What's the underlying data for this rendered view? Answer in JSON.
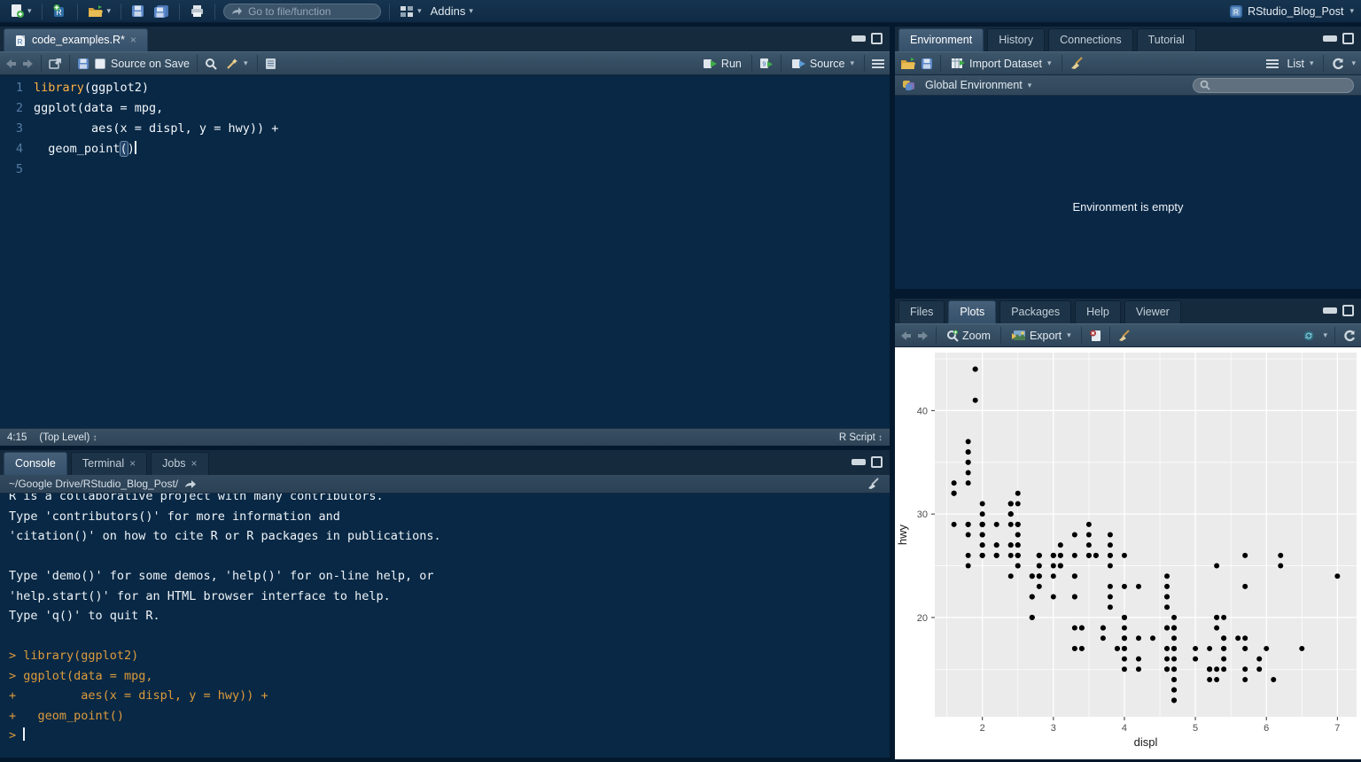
{
  "menubar": {
    "goto_placeholder": "Go to file/function",
    "addins_label": "Addins",
    "project_label": "RStudio_Blog_Post"
  },
  "source_pane": {
    "tab_name": "code_examples.R*",
    "source_on_save": "Source on Save",
    "run_label": "Run",
    "source_label": "Source",
    "status_position": "4:15",
    "status_scope": "(Top Level)",
    "status_type": "R Script"
  },
  "editor": {
    "lines": [
      {
        "num": "1",
        "parts": [
          {
            "t": "library",
            "c": "kw"
          },
          {
            "t": "(ggplot2)",
            "c": "pl"
          }
        ]
      },
      {
        "num": "2",
        "parts": [
          {
            "t": "ggplot(data = mpg,",
            "c": "pl"
          }
        ]
      },
      {
        "num": "3",
        "parts": [
          {
            "t": "        aes(x = displ, y = hwy)) +",
            "c": "pl"
          }
        ]
      },
      {
        "num": "4",
        "parts": [
          {
            "t": "  geom_point",
            "c": "pl"
          },
          {
            "t": "(",
            "c": "hl"
          },
          {
            "t": ")",
            "c": "pl"
          },
          {
            "t": "",
            "c": "caret"
          }
        ]
      },
      {
        "num": "5",
        "parts": []
      }
    ]
  },
  "console": {
    "tabs": [
      {
        "label": "Console",
        "active": true,
        "closable": false
      },
      {
        "label": "Terminal",
        "active": false,
        "closable": true
      },
      {
        "label": "Jobs",
        "active": false,
        "closable": true
      }
    ],
    "path": "~/Google Drive/RStudio_Blog_Post/",
    "lines": [
      {
        "t": "R is a collaborative project with many contributors.",
        "c": "info"
      },
      {
        "t": "Type 'contributors()' for more information and",
        "c": "info"
      },
      {
        "t": "'citation()' on how to cite R or R packages in publications.",
        "c": "info"
      },
      {
        "t": "",
        "c": "info"
      },
      {
        "t": "Type 'demo()' for some demos, 'help()' for on-line help, or",
        "c": "info"
      },
      {
        "t": "'help.start()' for an HTML browser interface to help.",
        "c": "info"
      },
      {
        "t": "Type 'q()' to quit R.",
        "c": "info"
      },
      {
        "t": "",
        "c": "info"
      },
      {
        "t": "> library(ggplot2)",
        "c": "input"
      },
      {
        "t": "> ggplot(data = mpg,",
        "c": "input"
      },
      {
        "t": "+         aes(x = displ, y = hwy)) +",
        "c": "input"
      },
      {
        "t": "+   geom_point()",
        "c": "input"
      },
      {
        "t": "> ",
        "c": "prompt"
      }
    ]
  },
  "environment": {
    "tabs": [
      {
        "label": "Environment",
        "active": true,
        "closable": false
      },
      {
        "label": "History",
        "active": false,
        "closable": false
      },
      {
        "label": "Connections",
        "active": false,
        "closable": false
      },
      {
        "label": "Tutorial",
        "active": false,
        "closable": false
      }
    ],
    "import_label": "Import Dataset",
    "list_label": "List",
    "selector_label": "Global Environment",
    "empty_text": "Environment is empty"
  },
  "plots": {
    "tabs": [
      {
        "label": "Files",
        "active": false,
        "closable": false
      },
      {
        "label": "Plots",
        "active": true,
        "closable": false
      },
      {
        "label": "Packages",
        "active": false,
        "closable": false
      },
      {
        "label": "Help",
        "active": false,
        "closable": false
      },
      {
        "label": "Viewer",
        "active": false,
        "closable": false
      }
    ],
    "zoom_label": "Zoom",
    "export_label": "Export"
  },
  "chart_data": {
    "type": "scatter",
    "title": "",
    "xlabel": "displ",
    "ylabel": "hwy",
    "x_axis": {
      "range": [
        1.33,
        7.27
      ],
      "major": [
        2,
        3,
        4,
        5,
        6,
        7
      ],
      "minor": [
        1.5,
        2.5,
        3.5,
        4.5,
        5.5,
        6.5
      ]
    },
    "y_axis": {
      "range": [
        10.4,
        45.6
      ],
      "major": [
        20,
        30,
        40
      ],
      "minor": [
        15,
        25,
        35,
        45
      ]
    },
    "style": {
      "panel_bg": "#ebebeb",
      "grid": "#ffffff",
      "point": "#000000",
      "tick_text": "#4d4d4d",
      "axis_title": "#1a1a1a"
    },
    "points": [
      [
        1.8,
        29
      ],
      [
        1.8,
        29
      ],
      [
        2.0,
        31
      ],
      [
        2.0,
        30
      ],
      [
        2.8,
        26
      ],
      [
        2.8,
        26
      ],
      [
        3.1,
        27
      ],
      [
        1.8,
        26
      ],
      [
        1.8,
        25
      ],
      [
        2.0,
        28
      ],
      [
        2.0,
        27
      ],
      [
        2.8,
        25
      ],
      [
        2.8,
        25
      ],
      [
        3.1,
        25
      ],
      [
        3.1,
        25
      ],
      [
        2.8,
        24
      ],
      [
        3.1,
        25
      ],
      [
        4.2,
        23
      ],
      [
        5.3,
        20
      ],
      [
        5.3,
        15
      ],
      [
        5.3,
        20
      ],
      [
        5.7,
        17
      ],
      [
        6.0,
        17
      ],
      [
        5.7,
        26
      ],
      [
        5.7,
        23
      ],
      [
        6.2,
        26
      ],
      [
        6.2,
        25
      ],
      [
        7.0,
        24
      ],
      [
        5.3,
        19
      ],
      [
        5.3,
        14
      ],
      [
        5.7,
        15
      ],
      [
        6.5,
        17
      ],
      [
        2.4,
        27
      ],
      [
        2.4,
        30
      ],
      [
        3.1,
        26
      ],
      [
        3.5,
        29
      ],
      [
        3.6,
        26
      ],
      [
        2.4,
        24
      ],
      [
        3.0,
        24
      ],
      [
        3.3,
        22
      ],
      [
        3.3,
        22
      ],
      [
        3.3,
        24
      ],
      [
        3.3,
        24
      ],
      [
        3.3,
        17
      ],
      [
        3.8,
        22
      ],
      [
        3.8,
        21
      ],
      [
        3.8,
        23
      ],
      [
        4.0,
        23
      ],
      [
        3.7,
        19
      ],
      [
        3.7,
        18
      ],
      [
        3.9,
        17
      ],
      [
        3.9,
        17
      ],
      [
        4.7,
        19
      ],
      [
        4.7,
        19
      ],
      [
        4.7,
        12
      ],
      [
        5.2,
        17
      ],
      [
        5.2,
        15
      ],
      [
        3.9,
        17
      ],
      [
        4.7,
        17
      ],
      [
        4.7,
        17
      ],
      [
        4.7,
        16
      ],
      [
        4.7,
        18
      ],
      [
        5.2,
        15
      ],
      [
        5.9,
        15
      ],
      [
        4.7,
        17
      ],
      [
        4.7,
        15
      ],
      [
        4.7,
        13
      ],
      [
        4.7,
        13
      ],
      [
        4.7,
        14
      ],
      [
        4.7,
        14
      ],
      [
        5.2,
        14
      ],
      [
        5.2,
        15
      ],
      [
        5.7,
        17
      ],
      [
        5.9,
        16
      ],
      [
        4.6,
        17
      ],
      [
        5.4,
        17
      ],
      [
        5.4,
        18
      ],
      [
        4.0,
        17
      ],
      [
        4.0,
        16
      ],
      [
        4.0,
        18
      ],
      [
        4.0,
        17
      ],
      [
        4.6,
        19
      ],
      [
        5.0,
        16
      ],
      [
        4.2,
        15
      ],
      [
        4.2,
        16
      ],
      [
        4.6,
        15
      ],
      [
        4.6,
        16
      ],
      [
        4.6,
        17
      ],
      [
        5.4,
        15
      ],
      [
        5.4,
        17
      ],
      [
        3.8,
        26
      ],
      [
        3.8,
        25
      ],
      [
        4.0,
        26
      ],
      [
        4.6,
        24
      ],
      [
        4.6,
        21
      ],
      [
        4.6,
        22
      ],
      [
        4.6,
        23
      ],
      [
        4.6,
        22
      ],
      [
        5.4,
        20
      ],
      [
        1.6,
        33
      ],
      [
        1.6,
        32
      ],
      [
        1.6,
        32
      ],
      [
        1.6,
        29
      ],
      [
        1.6,
        32
      ],
      [
        1.8,
        34
      ],
      [
        1.8,
        36
      ],
      [
        1.8,
        36
      ],
      [
        2.0,
        29
      ],
      [
        2.4,
        26
      ],
      [
        2.4,
        27
      ],
      [
        2.4,
        30
      ],
      [
        2.4,
        31
      ],
      [
        2.5,
        26
      ],
      [
        2.5,
        26
      ],
      [
        3.3,
        28
      ],
      [
        2.0,
        26
      ],
      [
        2.0,
        29
      ],
      [
        2.0,
        28
      ],
      [
        2.0,
        27
      ],
      [
        2.7,
        24
      ],
      [
        2.7,
        24
      ],
      [
        2.7,
        24
      ],
      [
        3.0,
        22
      ],
      [
        3.7,
        19
      ],
      [
        4.0,
        20
      ],
      [
        4.7,
        17
      ],
      [
        4.7,
        12
      ],
      [
        4.7,
        19
      ],
      [
        5.7,
        14
      ],
      [
        6.1,
        14
      ],
      [
        4.0,
        15
      ],
      [
        4.2,
        18
      ],
      [
        4.4,
        18
      ],
      [
        4.6,
        15
      ],
      [
        5.4,
        17
      ],
      [
        5.4,
        16
      ],
      [
        5.4,
        18
      ],
      [
        4.0,
        17
      ],
      [
        4.0,
        19
      ],
      [
        4.6,
        19
      ],
      [
        5.0,
        17
      ],
      [
        2.4,
        30
      ],
      [
        2.4,
        29
      ],
      [
        2.5,
        31
      ],
      [
        2.5,
        32
      ],
      [
        3.5,
        27
      ],
      [
        3.5,
        26
      ],
      [
        3.0,
        26
      ],
      [
        3.0,
        25
      ],
      [
        3.5,
        26
      ],
      [
        3.3,
        19
      ],
      [
        3.3,
        17
      ],
      [
        4.0,
        20
      ],
      [
        5.6,
        18
      ],
      [
        3.1,
        26
      ],
      [
        3.8,
        26
      ],
      [
        3.8,
        27
      ],
      [
        3.8,
        28
      ],
      [
        5.3,
        25
      ],
      [
        2.5,
        26
      ],
      [
        2.5,
        27
      ],
      [
        2.5,
        25
      ],
      [
        2.5,
        27
      ],
      [
        2.5,
        25
      ],
      [
        2.5,
        26
      ],
      [
        2.2,
        26
      ],
      [
        2.2,
        29
      ],
      [
        2.5,
        26
      ],
      [
        2.5,
        29
      ],
      [
        2.5,
        28
      ],
      [
        2.5,
        27
      ],
      [
        2.5,
        26
      ],
      [
        2.5,
        26
      ],
      [
        2.7,
        20
      ],
      [
        2.7,
        20
      ],
      [
        2.7,
        22
      ],
      [
        3.4,
        17
      ],
      [
        3.4,
        19
      ],
      [
        4.0,
        18
      ],
      [
        4.7,
        20
      ],
      [
        2.2,
        26
      ],
      [
        2.2,
        27
      ],
      [
        2.4,
        30
      ],
      [
        2.4,
        31
      ],
      [
        3.0,
        26
      ],
      [
        3.0,
        26
      ],
      [
        3.5,
        28
      ],
      [
        2.2,
        26
      ],
      [
        2.2,
        27
      ],
      [
        2.4,
        31
      ],
      [
        2.4,
        31
      ],
      [
        3.0,
        26
      ],
      [
        3.3,
        26
      ],
      [
        1.8,
        28
      ],
      [
        1.8,
        37
      ],
      [
        1.8,
        35
      ],
      [
        1.8,
        35
      ],
      [
        1.8,
        33
      ],
      [
        4.7,
        15
      ],
      [
        5.7,
        18
      ],
      [
        2.7,
        20
      ],
      [
        2.7,
        22
      ],
      [
        2.7,
        22
      ],
      [
        3.4,
        17
      ],
      [
        3.4,
        19
      ],
      [
        4.0,
        18
      ],
      [
        4.0,
        20
      ],
      [
        2.0,
        29
      ],
      [
        2.0,
        26
      ],
      [
        2.0,
        29
      ],
      [
        2.0,
        29
      ],
      [
        2.8,
        24
      ],
      [
        1.9,
        44
      ],
      [
        2.0,
        29
      ],
      [
        2.0,
        26
      ],
      [
        2.0,
        29
      ],
      [
        2.0,
        29
      ],
      [
        2.5,
        29
      ],
      [
        2.5,
        29
      ],
      [
        2.8,
        24
      ],
      [
        2.8,
        23
      ],
      [
        1.9,
        44
      ],
      [
        1.9,
        41
      ],
      [
        2.0,
        29
      ],
      [
        2.0,
        26
      ],
      [
        2.5,
        28
      ],
      [
        2.5,
        29
      ],
      [
        1.8,
        29
      ],
      [
        1.8,
        29
      ],
      [
        2.0,
        28
      ],
      [
        2.0,
        29
      ],
      [
        2.8,
        26
      ],
      [
        2.8,
        26
      ],
      [
        3.6,
        26
      ]
    ]
  }
}
